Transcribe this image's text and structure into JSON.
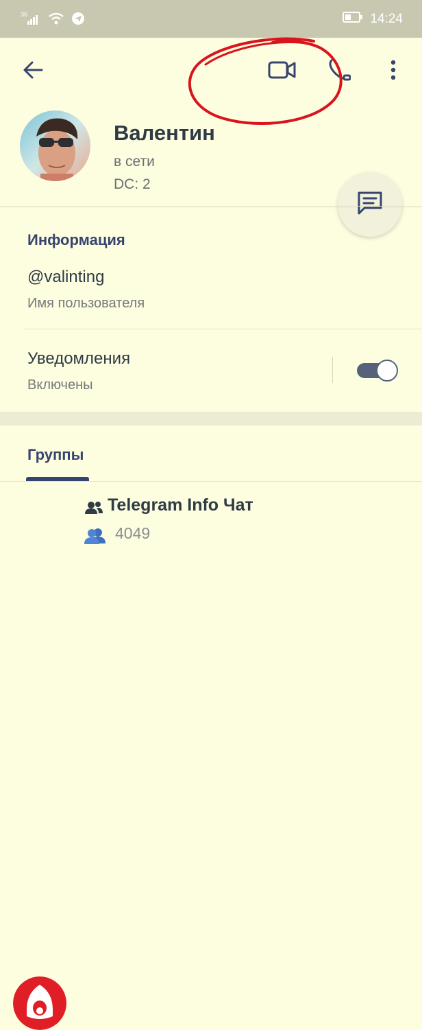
{
  "status_bar": {
    "signal": "36",
    "time": "14:24"
  },
  "icons": {
    "back": "back-arrow-icon",
    "video": "video-call-icon",
    "phone": "phone-icon",
    "more": "more-vert-icon",
    "message": "message-icon",
    "group_small": "group-icon",
    "members": "members-icon"
  },
  "profile": {
    "name": "Валентин",
    "status": "в сети",
    "dc": "DC: 2"
  },
  "info": {
    "title": "Информация",
    "username": "@valinting",
    "username_caption": "Имя пользователя",
    "notifications_label": "Уведомления",
    "notifications_value": "Включены",
    "notifications_enabled": true
  },
  "groups_tab": {
    "label": "Группы"
  },
  "groups": [
    {
      "name": "Telegram Info Чат",
      "members": "4049"
    }
  ],
  "colors": {
    "background": "#fdfde0",
    "accent": "#37456e",
    "annotation": "#d9141c"
  }
}
